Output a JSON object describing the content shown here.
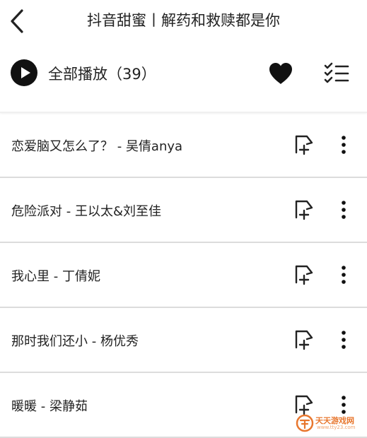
{
  "header": {
    "title": "抖音甜蜜丨解药和救赎都是你"
  },
  "playbar": {
    "play_all_label": "全部播放（39）"
  },
  "songs": [
    {
      "title": "恋爱脑又怎么了？ - 吴倩anya"
    },
    {
      "title": "危险派对 - 王以太&刘至佳"
    },
    {
      "title": "我心里 - 丁倩妮"
    },
    {
      "title": "那时我们还小 - 杨优秀"
    },
    {
      "title": "暖暖 - 梁静茹"
    }
  ],
  "watermark": {
    "name": "天天游戏网",
    "url": "www.tty23.com"
  },
  "colors": {
    "text": "#222222",
    "divider": "#dcdcdc",
    "watermark": "#e8772e"
  },
  "icons": [
    "back-arrow-icon",
    "play-icon",
    "heart-icon",
    "multi-select-icon",
    "add-to-playlist-icon",
    "more-vertical-icon"
  ]
}
